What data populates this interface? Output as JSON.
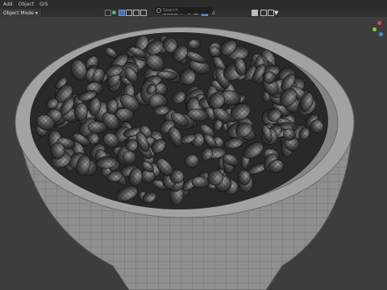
{
  "menu": {
    "items": [
      "Add",
      "Object",
      "GIS"
    ]
  },
  "header": {
    "mode_label": "Object Mode",
    "orientation_label": "Global",
    "search_placeholder": "Search"
  },
  "colors": {
    "background": "#3d3d3d",
    "bowl_body": "#8a8a8a",
    "nut_dark": "#262626",
    "accent_blue": "#4772b3",
    "axis_x": "#e0444f",
    "axis_y": "#7bcf3a",
    "axis_z": "#3a8fe0"
  },
  "icons": [
    "select-box-icon",
    "transform-pivot-icon",
    "snap-icon",
    "overlay-icon",
    "filter-icon",
    "navigation-gizmo-icon"
  ]
}
